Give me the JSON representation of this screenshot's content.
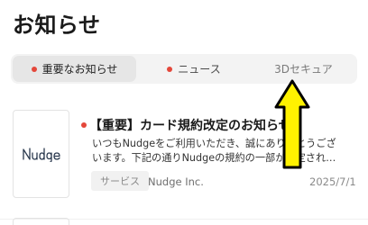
{
  "header": {
    "title": "お知らせ"
  },
  "tabs": [
    {
      "label": "重要なお知らせ",
      "active": true,
      "has_dot": true
    },
    {
      "label": "ニュース",
      "active": false,
      "has_dot": true
    },
    {
      "label": "3Dセキュア",
      "active": false,
      "has_dot": false
    }
  ],
  "notice": {
    "logo_icon": "nudge-logo",
    "title": "【重要】カード規約改定のお知らせ",
    "body_line1": "いつもNudgeをご利用いただき、誠にありがとうござ",
    "body_line2": "います。下記の通りNudgeの規約の一部が改定され…",
    "category": "サービス",
    "company": "Nudge Inc.",
    "date": "2025/7/1"
  },
  "annotation": {
    "icon": "arrow-up-icon",
    "color": "#FFF200",
    "outline": "#000000"
  },
  "colors": {
    "unread_dot": "#E4473A",
    "tab_bg": "#F3F3F3",
    "tab_active_bg": "#E6E6E6"
  }
}
